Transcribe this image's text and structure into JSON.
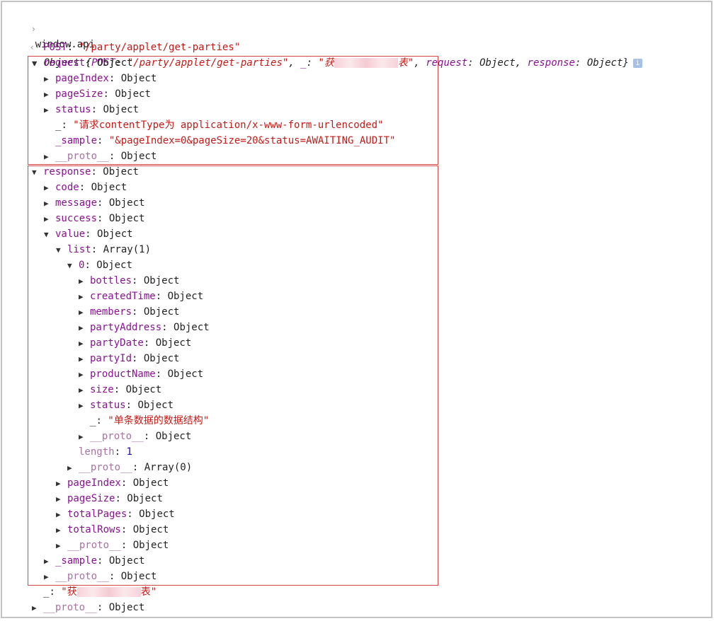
{
  "prompt": {
    "symbol": "›",
    "command": "window.api"
  },
  "result": {
    "marker": "‹·",
    "summary_type": "Object",
    "summary_post_key": "POST",
    "summary_post_val": "\"/party/applet/get-parties\"",
    "summary_us_key": "_",
    "summary_us_val_start": "\"获",
    "summary_us_val_end": "表\"",
    "summary_req_key": "request",
    "summary_resp_key": "response",
    "summary_obj": "Object",
    "info": "i"
  },
  "icons": {
    "expanded": "▼",
    "collapsed": "▶"
  },
  "lines": [
    {
      "id": "post",
      "key": "POST",
      "sep": ": ",
      "val": "\"/party/applet/get-parties\"",
      "type": "str"
    },
    {
      "id": "request",
      "key": "request",
      "sep": ": ",
      "val": "Object",
      "type": "obj"
    },
    {
      "id": "req-pageindex",
      "key": "pageIndex",
      "sep": ": ",
      "val": "Object",
      "type": "obj"
    },
    {
      "id": "req-pagesize",
      "key": "pageSize",
      "sep": ": ",
      "val": "Object",
      "type": "obj"
    },
    {
      "id": "req-status",
      "key": "status",
      "sep": ": ",
      "val": "Object",
      "type": "obj"
    },
    {
      "id": "req-underscore",
      "key": "_",
      "sep": ": ",
      "val": "\"请求contentType为 application/x-www-form-urlencoded\"",
      "type": "str"
    },
    {
      "id": "req-sample",
      "key": "_sample",
      "sep": ": ",
      "val": "\"&pageIndex=0&pageSize=20&status=AWAITING_AUDIT\"",
      "type": "str"
    },
    {
      "id": "req-proto",
      "key": "__proto__",
      "sep": ": ",
      "val": "Object",
      "type": "obj"
    },
    {
      "id": "response",
      "key": "response",
      "sep": ": ",
      "val": "Object",
      "type": "obj"
    },
    {
      "id": "resp-code",
      "key": "code",
      "sep": ": ",
      "val": "Object",
      "type": "obj"
    },
    {
      "id": "resp-message",
      "key": "message",
      "sep": ": ",
      "val": "Object",
      "type": "obj"
    },
    {
      "id": "resp-success",
      "key": "success",
      "sep": ": ",
      "val": "Object",
      "type": "obj"
    },
    {
      "id": "resp-value",
      "key": "value",
      "sep": ": ",
      "val": "Object",
      "type": "obj"
    },
    {
      "id": "val-list",
      "key": "list",
      "sep": ": ",
      "val": "Array(1)",
      "type": "obj"
    },
    {
      "id": "list-0",
      "key": "0",
      "sep": ": ",
      "val": "Object",
      "type": "obj"
    },
    {
      "id": "item-bottles",
      "key": "bottles",
      "sep": ": ",
      "val": "Object",
      "type": "obj"
    },
    {
      "id": "item-createdtime",
      "key": "createdTime",
      "sep": ": ",
      "val": "Object",
      "type": "obj"
    },
    {
      "id": "item-members",
      "key": "members",
      "sep": ": ",
      "val": "Object",
      "type": "obj"
    },
    {
      "id": "item-partyaddress",
      "key": "partyAddress",
      "sep": ": ",
      "val": "Object",
      "type": "obj"
    },
    {
      "id": "item-partydate",
      "key": "partyDate",
      "sep": ": ",
      "val": "Object",
      "type": "obj"
    },
    {
      "id": "item-partyid",
      "key": "partyId",
      "sep": ": ",
      "val": "Object",
      "type": "obj"
    },
    {
      "id": "item-productname",
      "key": "productName",
      "sep": ": ",
      "val": "Object",
      "type": "obj"
    },
    {
      "id": "item-size",
      "key": "size",
      "sep": ": ",
      "val": "Object",
      "type": "obj"
    },
    {
      "id": "item-status",
      "key": "status",
      "sep": ": ",
      "val": "Object",
      "type": "obj"
    },
    {
      "id": "item-underscore",
      "key": "_",
      "sep": ": ",
      "val": "\"单条数据的数据结构\"",
      "type": "str"
    },
    {
      "id": "item-proto",
      "key": "__proto__",
      "sep": ": ",
      "val": "Object",
      "type": "obj"
    },
    {
      "id": "list-length",
      "key": "length",
      "sep": ": ",
      "val": "1",
      "type": "num"
    },
    {
      "id": "list-proto",
      "key": "__proto__",
      "sep": ": ",
      "val": "Array(0)",
      "type": "obj"
    },
    {
      "id": "val-pageindex",
      "key": "pageIndex",
      "sep": ": ",
      "val": "Object",
      "type": "obj"
    },
    {
      "id": "val-pagesize",
      "key": "pageSize",
      "sep": ": ",
      "val": "Object",
      "type": "obj"
    },
    {
      "id": "val-totalpages",
      "key": "totalPages",
      "sep": ": ",
      "val": "Object",
      "type": "obj"
    },
    {
      "id": "val-totalrows",
      "key": "totalRows",
      "sep": ": ",
      "val": "Object",
      "type": "obj"
    },
    {
      "id": "val-proto",
      "key": "__proto__",
      "sep": ": ",
      "val": "Object",
      "type": "obj"
    },
    {
      "id": "resp-sample",
      "key": "_sample",
      "sep": ": ",
      "val": "Object",
      "type": "obj"
    },
    {
      "id": "resp-proto",
      "key": "__proto__",
      "sep": ": ",
      "val": "Object",
      "type": "obj"
    },
    {
      "id": "root-underscore",
      "key": "_",
      "sep": ": ",
      "val_start": "\"获",
      "val_end": "表\"",
      "type": "str"
    },
    {
      "id": "root-proto",
      "key": "__proto__",
      "sep": ": ",
      "val": "Object",
      "type": "obj"
    }
  ],
  "colors": {
    "key": "#881391",
    "string": "#c41a16",
    "number": "#1c00cf",
    "proto": "#a971a4",
    "highlight_box": "#d64545"
  }
}
